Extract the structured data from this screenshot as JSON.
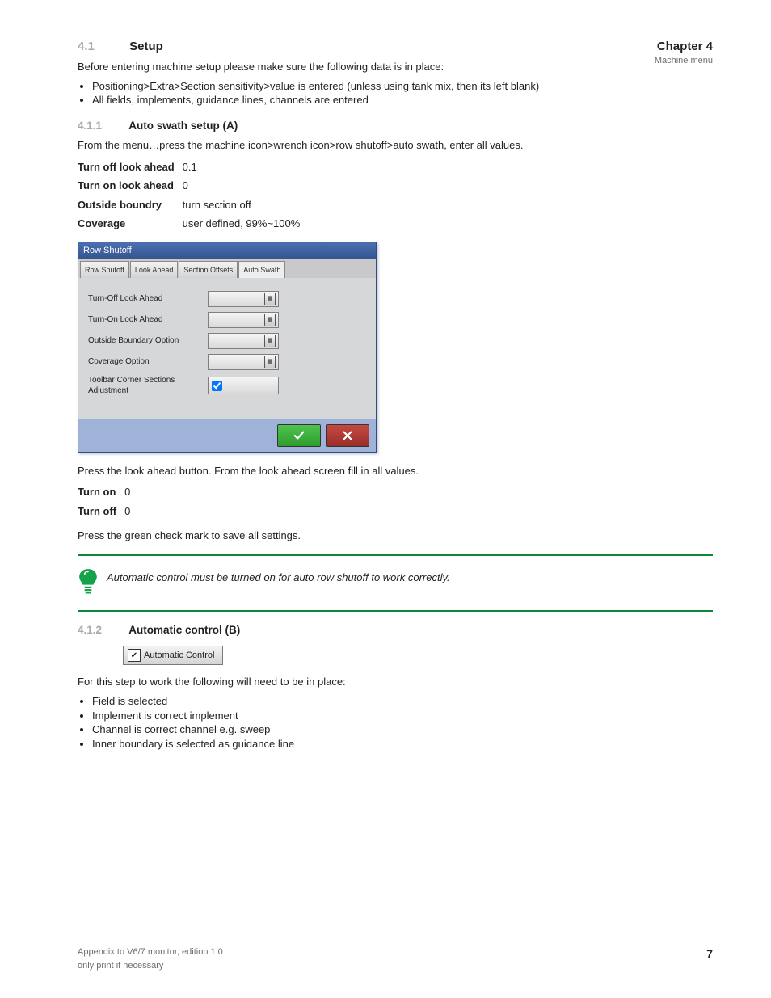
{
  "chapter": {
    "title": "Chapter 4",
    "subtitle": "Machine menu"
  },
  "section41": {
    "number": "4.1",
    "title": "Setup",
    "p1": "Before entering machine setup please make sure the following data is in place:",
    "bullets": [
      "Positioning>Extra>Section sensitivity>value is entered (unless using tank mix, then its left blank)",
      "All fields, implements, guidance lines, channels are entered"
    ],
    "sub_number": "4.1.1",
    "sub_title": "Auto swath setup (A)",
    "p2": "From the menu…press the machine icon>wrench icon>row shutoff>auto swath, enter all values.",
    "table": [
      [
        "Turn off look ahead",
        "0.1"
      ],
      [
        "Turn on look ahead",
        "0"
      ],
      [
        "Outside boundry",
        "turn section off"
      ],
      [
        "Coverage",
        "user defined, 99%~100%"
      ]
    ],
    "dialog": {
      "title": "Row Shutoff",
      "tabs": [
        "Row Shutoff",
        "Look Ahead",
        "Section Offsets",
        "Auto Swath"
      ],
      "active_tab": 3,
      "fields": [
        {
          "label": "Turn-Off Look Ahead",
          "kind": "num"
        },
        {
          "label": "Turn-On Look Ahead",
          "kind": "num"
        },
        {
          "label": "Outside Boundary Option",
          "kind": "num"
        },
        {
          "label": "Coverage Option",
          "kind": "num"
        },
        {
          "label": "Toolbar Corner Sections Adjustment",
          "kind": "check"
        }
      ]
    },
    "p3": "Press the look ahead button. From the look ahead screen fill in all values.",
    "table2": [
      [
        "Turn on",
        "0"
      ],
      [
        "Turn off",
        "0"
      ]
    ],
    "p4": "Press the green check mark to save all settings."
  },
  "tip": "Automatic control must be turned on for auto row shutoff to work correctly.",
  "section412": {
    "number": "4.1.2",
    "title": "Automatic control (B)",
    "button_label": "Automatic Control",
    "p1": "For this step to work the following will need to be in place:",
    "bullets": [
      "Field is selected",
      "Implement is correct implement",
      "Channel is correct channel e.g. sweep",
      "Inner boundary is selected as guidance line"
    ]
  },
  "footer": {
    "doc_id": "Appendix to V6/7 monitor, edition 1.0",
    "print_note": "only print if necessary",
    "page": "7"
  }
}
